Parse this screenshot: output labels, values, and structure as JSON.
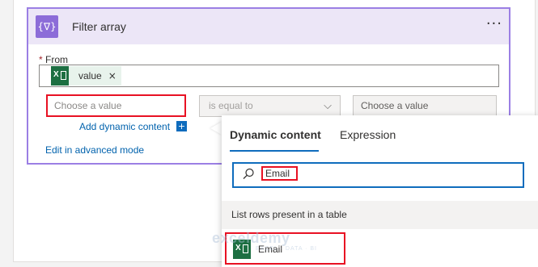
{
  "card": {
    "title": "Filter array",
    "icon": "curly-filter-icon",
    "icon_glyph": "{∇}",
    "more_label": "···",
    "accent_color": "#8c6cd8"
  },
  "from": {
    "label": "From",
    "required_mark": "*",
    "token_label": "value",
    "token_remove": "×"
  },
  "condition": {
    "left_placeholder": "Choose a value",
    "operator": "is equal to",
    "right_placeholder": "Choose a value"
  },
  "links": {
    "add_dynamic": "Add dynamic content",
    "plus": "+",
    "edit_advanced": "Edit in advanced mode"
  },
  "dynamic_panel": {
    "tabs": [
      "Dynamic content",
      "Expression"
    ],
    "active_tab": "Dynamic content",
    "search_value": "Email",
    "section_header": "List rows present in a table",
    "items": [
      {
        "label": "Email",
        "icon": "excel-icon"
      }
    ]
  },
  "watermark": {
    "text": "exceldemy",
    "sub": "EXCEL · DATA · BI"
  },
  "colors": {
    "highlight_red": "#e81123",
    "link_blue": "#0062ad",
    "excel_green": "#1d6f42"
  }
}
